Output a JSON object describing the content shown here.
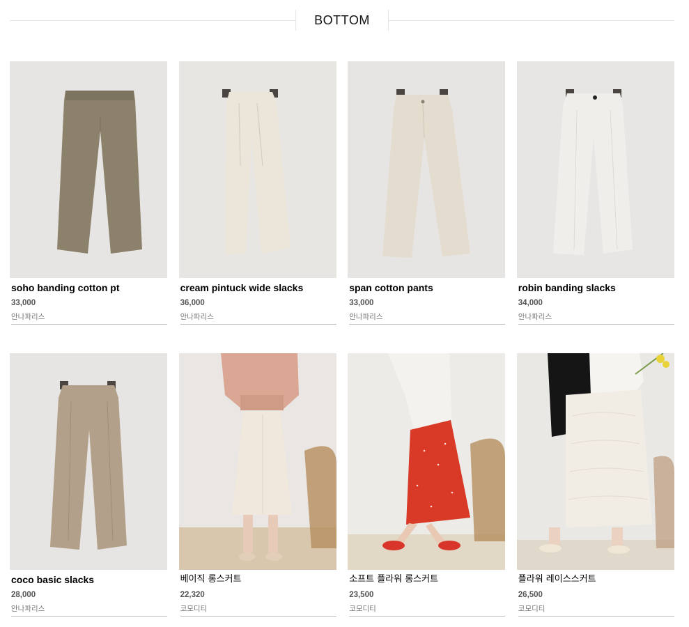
{
  "section": {
    "title": "BOTTOM"
  },
  "products": [
    {
      "name": "soho banding cotton pt",
      "price": "33,000",
      "brand": "안나파리스",
      "image": "pants-khaki",
      "color": "#8a7f68"
    },
    {
      "name": "cream pintuck wide slacks",
      "price": "36,000",
      "brand": "안나파리스",
      "image": "pants-cream-wide",
      "color": "#e6ded3"
    },
    {
      "name": "span cotton pants",
      "price": "33,000",
      "brand": "안나파리스",
      "image": "pants-ivory",
      "color": "#e2dbd0"
    },
    {
      "name": "robin banding slacks",
      "price": "34,000",
      "brand": "안나파리스",
      "image": "pants-white",
      "color": "#eeece8"
    },
    {
      "name": "coco basic slacks",
      "price": "28,000",
      "brand": "안나파리스",
      "image": "pants-beige",
      "color": "#b09d88"
    },
    {
      "name": "베이직 롱스커트",
      "price": "22,320",
      "brand": "코모디티",
      "image": "skirt-ivory-model",
      "color": "#efe7dc"
    },
    {
      "name": "소프트 플라워 롱스커트",
      "price": "23,500",
      "brand": "코모디티",
      "image": "skirt-red-floral-model",
      "color": "#d93a26"
    },
    {
      "name": "플라워 레이스스커트",
      "price": "26,500",
      "brand": "코모디티",
      "image": "skirt-lace-model",
      "color": "#f1ede6"
    }
  ]
}
